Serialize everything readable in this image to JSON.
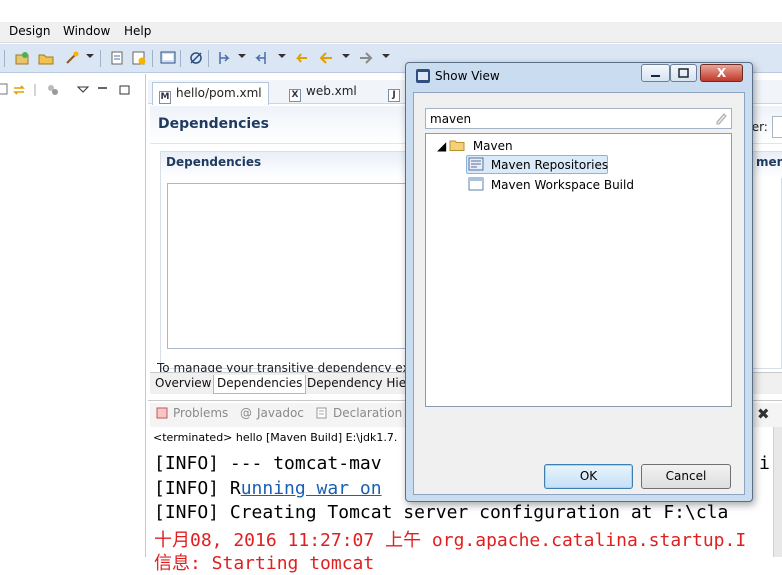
{
  "menu": {
    "items": [
      "Design",
      "Window",
      "Help"
    ]
  },
  "editor": {
    "tabs": [
      "hello/pom.xml",
      "web.xml",
      "J"
    ],
    "form_title": "Dependencies",
    "filter_label": "ter:",
    "section_title": "Dependencies",
    "section_title_right": "ment",
    "hint": "To manage your transitive dependency exc",
    "bottom_tabs": [
      "Overview",
      "Dependencies",
      "Dependency Hier"
    ]
  },
  "console": {
    "tabs": [
      "Problems",
      "Javadoc",
      "Declaration"
    ],
    "terminated": "<terminated> hello [Maven Build] E:\\jdk1.7.",
    "lines": [
      {
        "text": "[INFO] --- tomcat-mav",
        "tail": "i)"
      },
      {
        "prefix": "[INFO] R",
        "link": "unning war on"
      },
      {
        "text": "[INFO] Creating Tomcat server configuration at F:\\cla"
      },
      {
        "text": "十月08, 2016 11:27:07 上午 org.apache.catalina.startup.I"
      },
      {
        "text": "信息: Starting tomcat"
      }
    ]
  },
  "dialog": {
    "title": "Show View",
    "close_label": "X",
    "search_value": "maven",
    "tree": {
      "folder": "Maven",
      "items": [
        "Maven Repositories",
        "Maven Workspace Build"
      ],
      "selected_index": 0
    },
    "ok_label": "OK",
    "cancel_label": "Cancel"
  },
  "colors": {
    "toolbar_bg": "#dbe6f4",
    "dialog_frame": "#c9dcf0",
    "console_red": "#e02020",
    "link_blue": "#1a5fb4",
    "section_title": "#1f3a5f"
  }
}
